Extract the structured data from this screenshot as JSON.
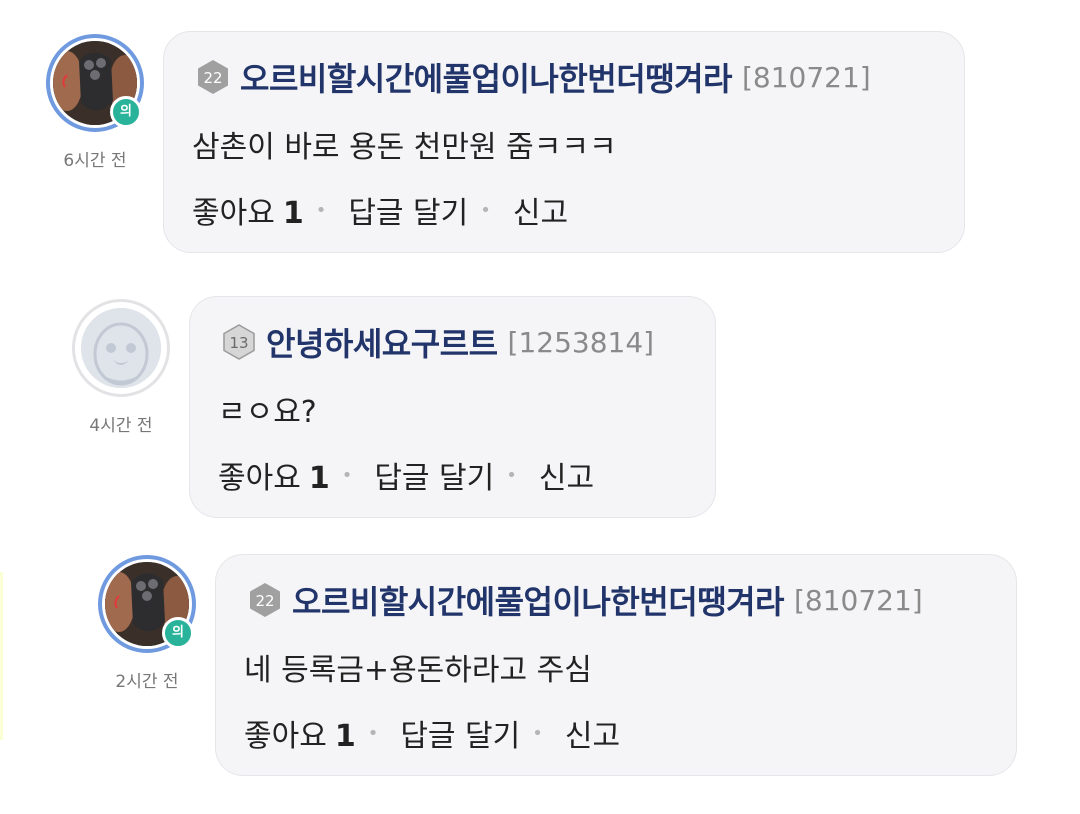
{
  "comments": [
    {
      "avatar_type": "photo",
      "avatar_badge": "의",
      "level": "22",
      "nickname": "오르비할시간에풀업이나한번더땡겨라",
      "user_id": "[810721]",
      "time": "6시간 전",
      "text": "삼촌이 바로 용돈 천만원 줌ㅋㅋㅋ",
      "like_label": "좋아요",
      "like_count": "1",
      "reply_label": "답글 달기",
      "report_label": "신고"
    },
    {
      "avatar_type": "default",
      "level": "13",
      "nickname": "안녕하세요구르트",
      "user_id": "[1253814]",
      "time": "4시간 전",
      "text": "ㄹㅇ요?",
      "like_label": "좋아요",
      "like_count": "1",
      "reply_label": "답글 달기",
      "report_label": "신고"
    },
    {
      "avatar_type": "photo",
      "avatar_badge": "의",
      "level": "22",
      "nickname": "오르비할시간에풀업이나한번더땡겨라",
      "user_id": "[810721]",
      "time": "2시간 전",
      "text": "네 등록금+용돈하라고 주심",
      "like_label": "좋아요",
      "like_count": "1",
      "reply_label": "답글 달기",
      "report_label": "신고"
    }
  ],
  "colors": {
    "nickname": "#22356b",
    "avatar_ring": "#6f9ae0",
    "badge_green": "#29b39a",
    "bubble_bg": "#f5f5f7",
    "level_badge": "#a0a0a0"
  },
  "icons": {
    "level_badge": "hexagon-level-icon",
    "avatar_badge": "medical-badge-icon",
    "default_avatar": "penguin-avatar-icon"
  }
}
